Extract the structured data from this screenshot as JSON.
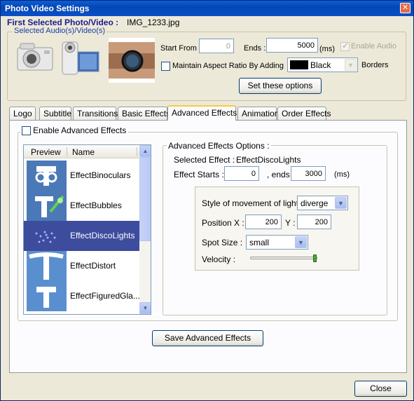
{
  "window": {
    "title": "Photo Video Settings",
    "close_glyph": "✕"
  },
  "header": {
    "first_selected_label": "First Selected Photo/Video :",
    "first_selected_file": "IMG_1233.jpg"
  },
  "selected_media": {
    "legend": "Selected Audio(s)/Video(s)",
    "start_from_label": "Start From :",
    "start_from_value": "0",
    "ends_label": "Ends :",
    "ends_value": "5000",
    "ends_unit": "(ms)",
    "enable_audio_label": "Enable Audio",
    "enable_audio_checked": true,
    "maintain_aspect_label": "Maintain Aspect Ratio By Adding",
    "maintain_aspect_checked": false,
    "border_color_value": "Black",
    "border_color_swatch": "#000000",
    "borders_label": "Borders",
    "set_options_button": "Set these options"
  },
  "tabs": [
    {
      "label": "Logo"
    },
    {
      "label": "Subtitle"
    },
    {
      "label": "Transitions"
    },
    {
      "label": "Basic Effects"
    },
    {
      "label": "Advanced Effects",
      "active": true
    },
    {
      "label": "Animation"
    },
    {
      "label": "Order Effects"
    }
  ],
  "advanced": {
    "enable_label": "Enable Advanced Effects",
    "enable_checked": false,
    "list": {
      "col_preview": "Preview",
      "col_name": "Name",
      "items": [
        {
          "name": "EffectBinoculars"
        },
        {
          "name": "EffectBubbles"
        },
        {
          "name": "EffectDiscoLights",
          "selected": true
        },
        {
          "name": "EffectDistort"
        },
        {
          "name": "EffectFiguredGla..."
        }
      ]
    },
    "options": {
      "legend": "Advanced Effects Options :",
      "selected_effect_label": "Selected Effect :",
      "selected_effect_value": "EffectDiscoLights",
      "effect_starts_label": "Effect Starts :",
      "effect_starts_value": "0",
      "ends_label": ", ends :",
      "ends_value": "3000",
      "unit": "(ms)",
      "style_label": "Style of movement of lights :",
      "style_value": "diverge",
      "position_label": "Position X :",
      "position_x": "200",
      "y_label": "Y :",
      "position_y": "200",
      "spot_size_label": "Spot Size :",
      "spot_size_value": "small",
      "velocity_label": "Velocity :",
      "velocity_level": 1.0
    },
    "save_button": "Save Advanced Effects"
  },
  "footer": {
    "close_button": "Close"
  },
  "colors": {
    "title_bar": "#0a4fc8",
    "face": "#ece9d8",
    "selection": "#3d4c9c",
    "legend_text": "#1c3ca0"
  }
}
